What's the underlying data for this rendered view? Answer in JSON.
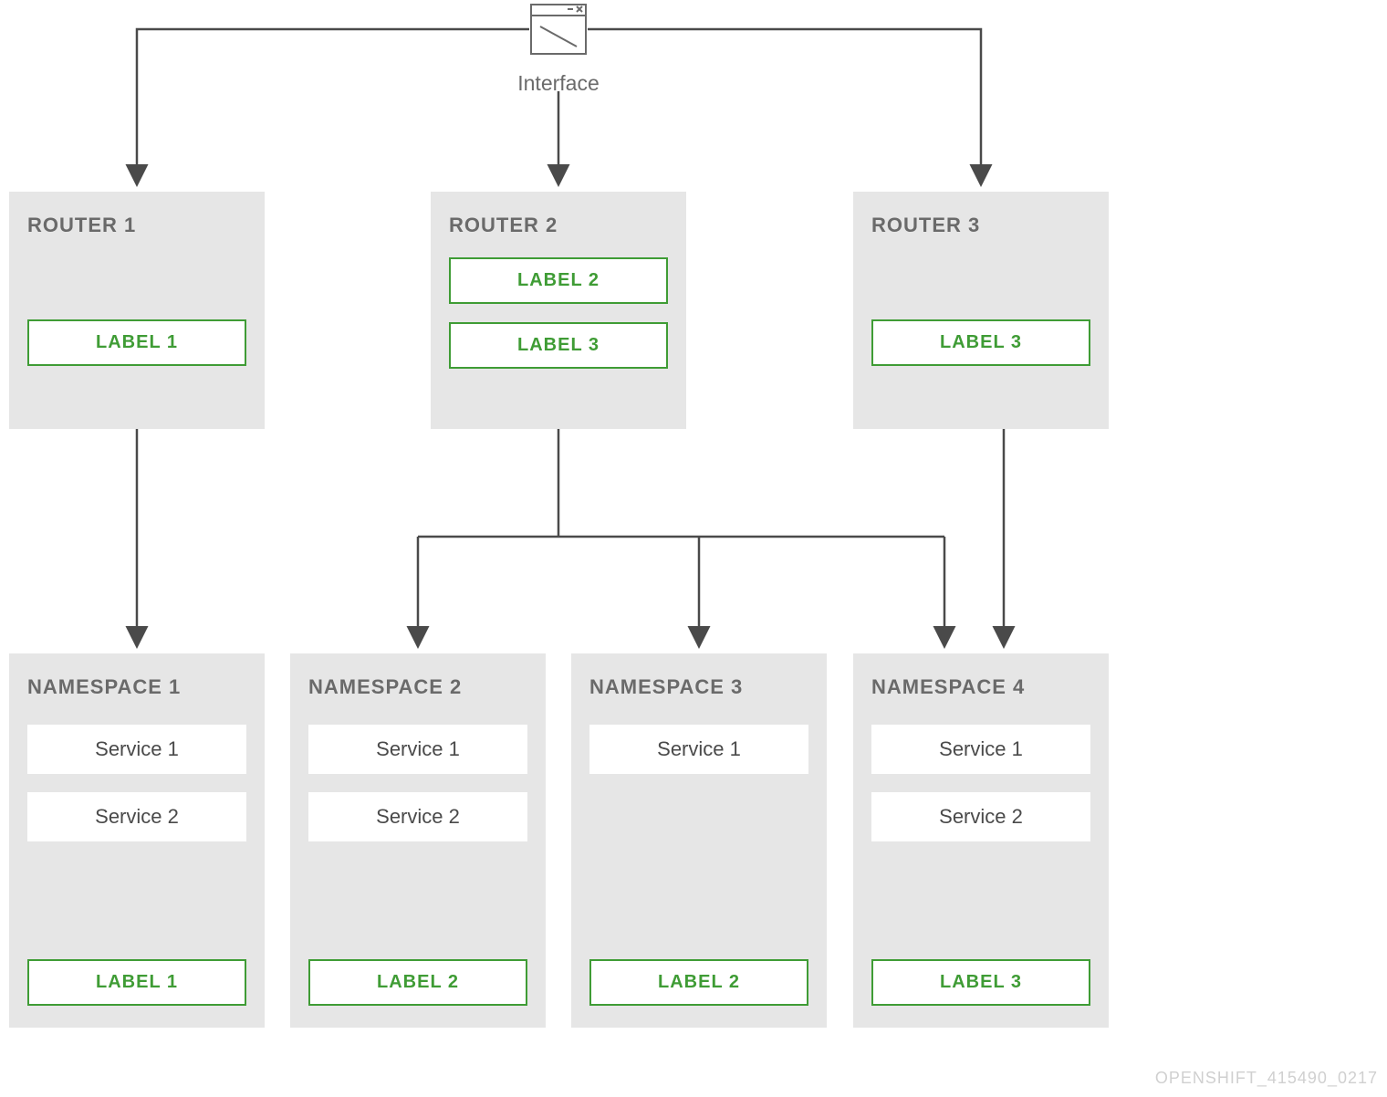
{
  "interface": {
    "label": "Interface"
  },
  "routers": [
    {
      "title": "ROUTER 1",
      "labels": [
        "LABEL 1"
      ]
    },
    {
      "title": "ROUTER 2",
      "labels": [
        "LABEL 2",
        "LABEL 3"
      ]
    },
    {
      "title": "ROUTER 3",
      "labels": [
        "LABEL 3"
      ]
    }
  ],
  "namespaces": [
    {
      "title": "NAMESPACE 1",
      "services": [
        "Service 1",
        "Service 2"
      ],
      "label": "LABEL 1"
    },
    {
      "title": "NAMESPACE 2",
      "services": [
        "Service 1",
        "Service 2"
      ],
      "label": "LABEL 2"
    },
    {
      "title": "NAMESPACE 3",
      "services": [
        "Service 1"
      ],
      "label": "LABEL 2"
    },
    {
      "title": "NAMESPACE 4",
      "services": [
        "Service 1",
        "Service 2"
      ],
      "label": "LABEL 3"
    }
  ],
  "watermark": "OPENSHIFT_415490_0217"
}
